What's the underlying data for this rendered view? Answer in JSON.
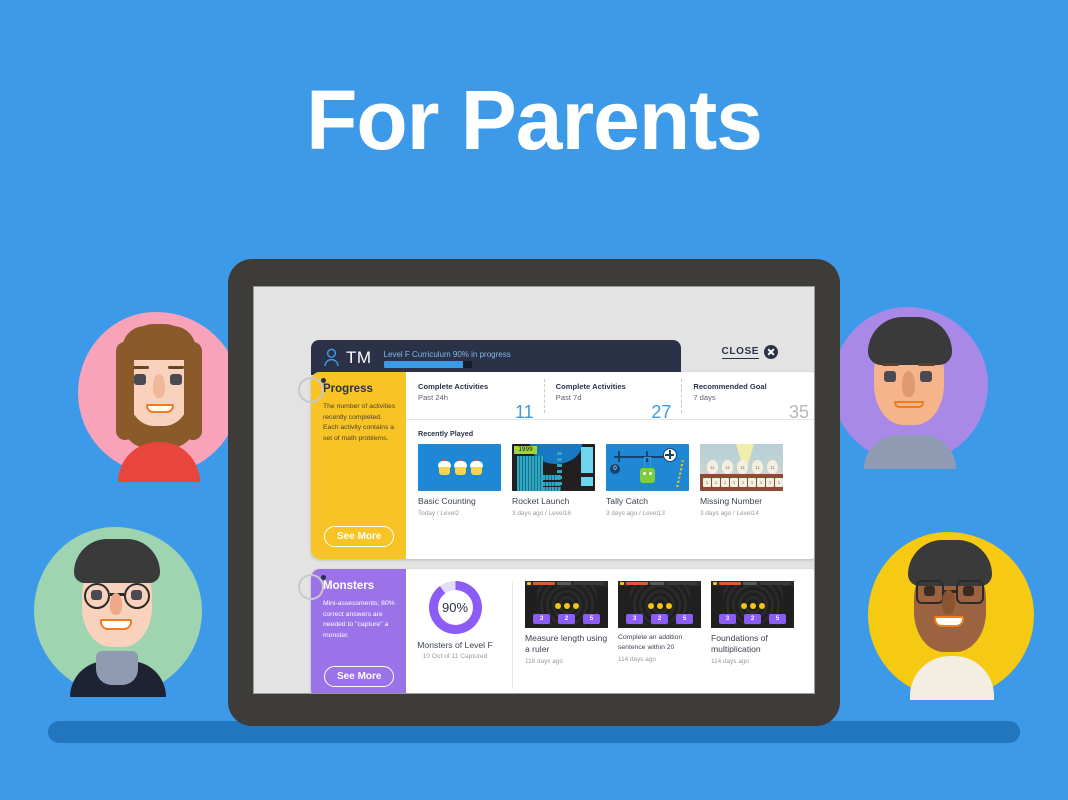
{
  "headline": "For Parents",
  "topbar": {
    "user_icon": "person-icon",
    "initials": "TM",
    "progress_label": "Level F Curriculum 90% in progress",
    "progress_percent": 90,
    "close_label": "CLOSE",
    "close_icon": "close-circle-icon"
  },
  "progress_card": {
    "title": "Progress",
    "description": "The number of activities recently completed. Each activity contains a set of math problems.",
    "see_more": "See More",
    "accent_color": "#f7c325",
    "stats": [
      {
        "label": "Complete Activities",
        "sub": "Past 24h",
        "value": "11",
        "color": "#3d9ae8"
      },
      {
        "label": "Complete Activities",
        "sub": "Past 7d",
        "value": "27",
        "color": "#3d9ae8"
      },
      {
        "label": "Recommended Goal",
        "sub": "7 days",
        "value": "35",
        "color": "#b7b7b7"
      }
    ],
    "recently_played_label": "Recently Played",
    "games": [
      {
        "title": "Basic Counting",
        "meta": "Today / Level2"
      },
      {
        "title": "Rocket Launch",
        "meta": "3 days ago / Level16",
        "score": "1999"
      },
      {
        "title": "Tally Catch",
        "meta": "3 days ago / Level13",
        "badge": "0"
      },
      {
        "title": "Missing Number",
        "meta": "3 days ago / Level14"
      }
    ]
  },
  "monsters_card": {
    "title": "Monsters",
    "description": "Mini-assessments; 80% correct answers are needed to \"capture\" a monster.",
    "see_more": "See More",
    "accent_color": "#9b72e8",
    "donut": {
      "value": "90%",
      "percent": 90,
      "title": "Monsters of Level F",
      "sub": "10 Out of 11 Captured"
    },
    "assessments": [
      {
        "title": "Measure length using a ruler",
        "meta": "118 days ago",
        "small": false,
        "answers": [
          "3",
          "2",
          "5"
        ]
      },
      {
        "title": "Complete an addition sentence within 20",
        "meta": "114 days ago",
        "small": true,
        "answers": [
          "3",
          "2",
          "5"
        ]
      },
      {
        "title": "Foundations of multiplication",
        "meta": "114 days ago",
        "small": false,
        "answers": [
          "3",
          "2",
          "5"
        ]
      }
    ]
  },
  "avatars": [
    {
      "name": "avatar-mother",
      "blob": "#f9a3ba",
      "skin": "#f8d2bd",
      "hair": "#8a5a2b",
      "shirt": "#e8453c"
    },
    {
      "name": "avatar-father",
      "blob": "#a889e8",
      "skin": "#f6b48a",
      "hair": "#3a3a3a",
      "shirt": "#8e9bb3"
    },
    {
      "name": "avatar-grandparent",
      "blob": "#9ed4b0",
      "skin": "#f8d2bd",
      "hair": "#3a3a3a",
      "shirt": "#1d2333"
    },
    {
      "name": "avatar-teacher",
      "blob": "#f6c913",
      "skin": "#9b6340",
      "hair": "#3a3a3a",
      "shirt": "#f2efe2"
    }
  ],
  "colors": {
    "background": "#3d9ae8",
    "shelf": "#2176bd",
    "tablet_frame": "#3e3c39",
    "screen": "#e3e3e3",
    "topbar": "#2b3247"
  }
}
